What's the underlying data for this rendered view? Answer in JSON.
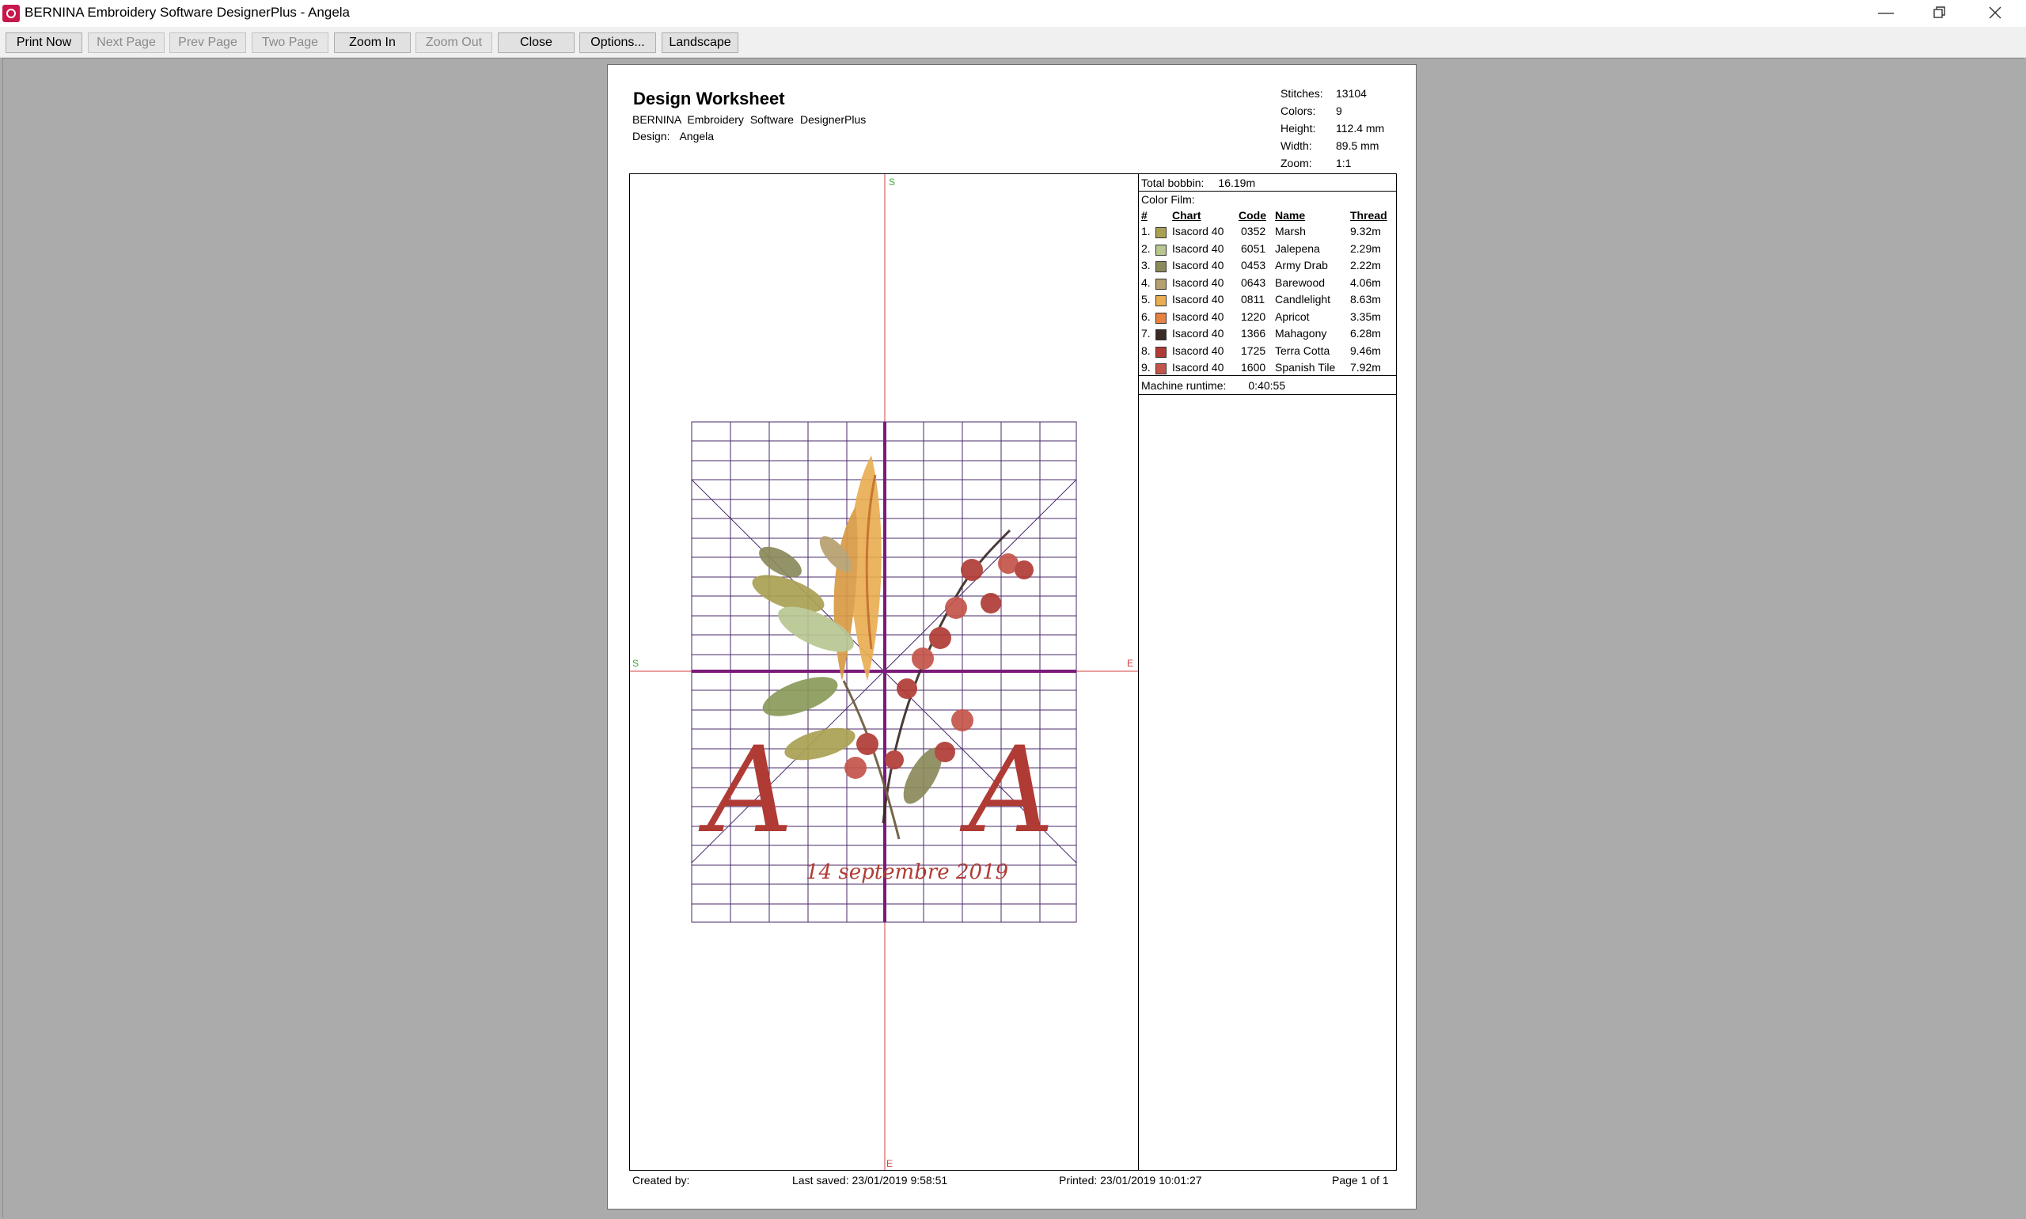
{
  "window": {
    "title": "BERNINA Embroidery Software DesignerPlus - Angela"
  },
  "toolbar": {
    "buttons": [
      {
        "label": "Print Now",
        "enabled": true
      },
      {
        "label": "Next Page",
        "enabled": false
      },
      {
        "label": "Prev Page",
        "enabled": false
      },
      {
        "label": "Two Page",
        "enabled": false
      },
      {
        "label": "Zoom In",
        "enabled": true
      },
      {
        "label": "Zoom Out",
        "enabled": false
      },
      {
        "label": "Close",
        "enabled": true
      },
      {
        "label": "Options...",
        "enabled": true
      },
      {
        "label": "Landscape",
        "enabled": true
      }
    ]
  },
  "worksheet": {
    "title": "Design Worksheet",
    "subtitle": "BERNINA Embroidery Software DesignerPlus",
    "design_label": "Design:",
    "design_name": "Angela",
    "stats": [
      {
        "label": "Stitches:",
        "value": "13104"
      },
      {
        "label": "Colors:",
        "value": "9"
      },
      {
        "label": "Height:",
        "value": "112.4 mm"
      },
      {
        "label": "Width:",
        "value": "89.5 mm"
      },
      {
        "label": "Zoom:",
        "value": "1:1"
      }
    ],
    "markers": {
      "start": "S",
      "end": "E"
    },
    "design_text": "14 septembre 2019",
    "monogram": "A"
  },
  "threads": {
    "total_bobbin_label": "Total bobbin:",
    "total_bobbin": "16.19m",
    "color_film_label": "Color Film:",
    "headers": {
      "num": "#",
      "chart": "Chart",
      "code": "Code",
      "name": "Name",
      "thread": "Thread"
    },
    "rows": [
      {
        "num": "1.",
        "chart": "Isacord 40",
        "code": "0352",
        "name": "Marsh",
        "thread": "9.32m",
        "color": "#a9a152"
      },
      {
        "num": "2.",
        "chart": "Isacord 40",
        "code": "6051",
        "name": "Jalepena",
        "thread": "2.29m",
        "color": "#b8c690"
      },
      {
        "num": "3.",
        "chart": "Isacord 40",
        "code": "0453",
        "name": "Army Drab",
        "thread": "2.22m",
        "color": "#8a8a5a"
      },
      {
        "num": "4.",
        "chart": "Isacord 40",
        "code": "0643",
        "name": "Barewood",
        "thread": "4.06m",
        "color": "#b6a070"
      },
      {
        "num": "5.",
        "chart": "Isacord 40",
        "code": "0811",
        "name": "Candlelight",
        "thread": "8.63m",
        "color": "#e9ae52"
      },
      {
        "num": "6.",
        "chart": "Isacord 40",
        "code": "1220",
        "name": "Apricot",
        "thread": "3.35m",
        "color": "#e8823e"
      },
      {
        "num": "7.",
        "chart": "Isacord 40",
        "code": "1366",
        "name": "Mahagony",
        "thread": "6.28m",
        "color": "#3a2a26"
      },
      {
        "num": "8.",
        "chart": "Isacord 40",
        "code": "1725",
        "name": "Terra Cotta",
        "thread": "9.46m",
        "color": "#b03a34"
      },
      {
        "num": "9.",
        "chart": "Isacord 40",
        "code": "1600",
        "name": "Spanish Tile",
        "thread": "7.92m",
        "color": "#c4544a"
      }
    ],
    "runtime_label": "Machine runtime:",
    "runtime": "0:40:55"
  },
  "footer": {
    "created": "Created by:",
    "saved_label": "Last saved:",
    "saved": "23/01/2019 9:58:51",
    "printed_label": "Printed:",
    "printed": "23/01/2019 10:01:27",
    "page": "Page 1 of 1"
  }
}
